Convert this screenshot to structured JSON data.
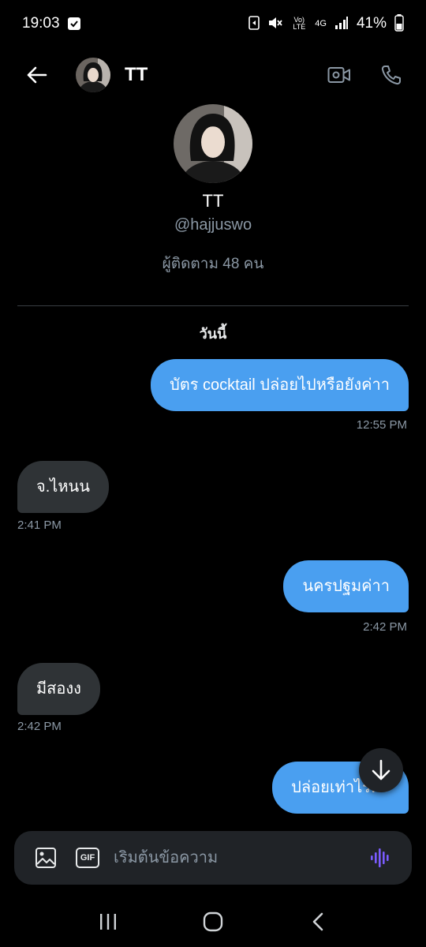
{
  "status_bar": {
    "time": "19:03",
    "battery": "41%",
    "network": "4G",
    "volte": "Vo) LTE"
  },
  "header": {
    "name": "TT"
  },
  "profile": {
    "name": "TT",
    "handle": "@hajjuswo",
    "followers": "ผู้ติดตาม 48 คน"
  },
  "day_label": "วันนี้",
  "messages": [
    {
      "direction": "out",
      "text": "บัตร cocktail ปล่อยไปหรือยังค่าา",
      "time": "12:55 PM"
    },
    {
      "direction": "in",
      "text": "จ.ไหนน",
      "time": "2:41 PM"
    },
    {
      "direction": "out",
      "text": "นครปฐมค่าา",
      "time": "2:42 PM"
    },
    {
      "direction": "in",
      "text": "มีสองง",
      "time": "2:42 PM"
    },
    {
      "direction": "out",
      "text": "ปล่อยเท่าไรคะ",
      "time": ""
    }
  ],
  "composer": {
    "placeholder": "เริ่มต้นข้อความ",
    "gif_label": "GIF"
  },
  "colors": {
    "accent": "#4a9ff0",
    "incoming_bubble": "#2f3336",
    "voice_icon": "#7b5cff"
  }
}
